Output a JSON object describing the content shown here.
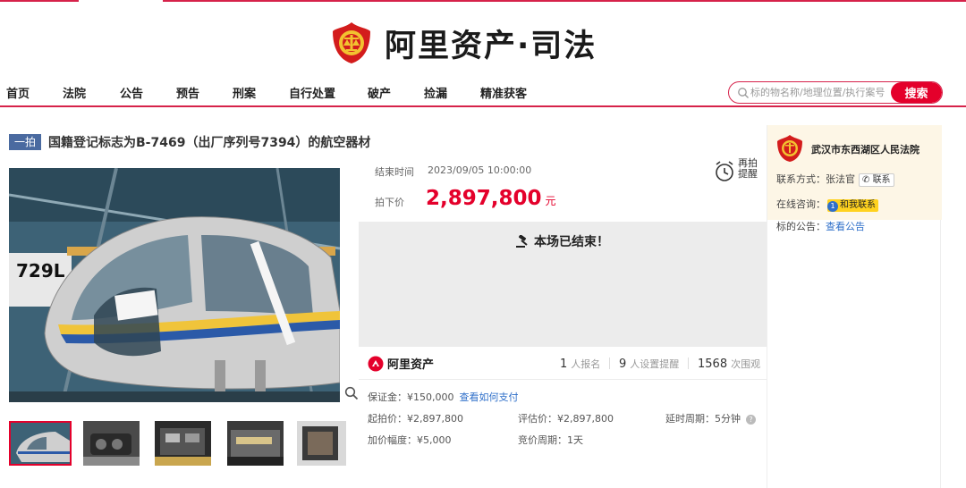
{
  "brand": {
    "title": "阿里资产·司法"
  },
  "nav": {
    "items": [
      "首页",
      "法院",
      "公告",
      "预告",
      "刑案",
      "自行处置",
      "破产",
      "捡漏",
      "精准获客"
    ]
  },
  "search": {
    "placeholder": "标的物名称/地理位置/执行案号",
    "button": "搜索"
  },
  "item": {
    "badge": "一拍",
    "title": "国籍登记标志为B-7469（出厂序列号7394）的航空器材"
  },
  "auction": {
    "end_time_label": "结束时间",
    "end_time": "2023/09/05 10:00:00",
    "remind_label": "再拍提醒",
    "price_label": "拍下价",
    "price": "2,897,800",
    "price_unit": "元",
    "ended_text": "本场已结束！"
  },
  "stats": {
    "brand": "阿里资产",
    "signups": "1",
    "signups_label": "人报名",
    "reminders": "9",
    "reminders_label": "人设置提醒",
    "views": "1568",
    "views_label": "次围观"
  },
  "details": {
    "deposit": "保证金：¥150,000",
    "deposit_link": "查看如何支付",
    "start_price": "起拍价：¥2,897,800",
    "appraisal": "评估价：¥2,897,800",
    "delay": "延时周期：5分钟",
    "increment": "加价幅度：¥5,000",
    "cycle": "竞价周期：1天"
  },
  "court": {
    "name": "武汉市东西湖区人民法院",
    "contact_label": "联系方式：",
    "contact_person": "张法官",
    "contact_button": "联系",
    "consult_label": "在线咨询：",
    "consult_button": "和我联系",
    "notice_label": "标的公告：",
    "notice_link": "查看公告"
  },
  "colors": {
    "accent": "#e4002b",
    "link": "#2f6fc9",
    "badge": "#4a6aa0"
  }
}
